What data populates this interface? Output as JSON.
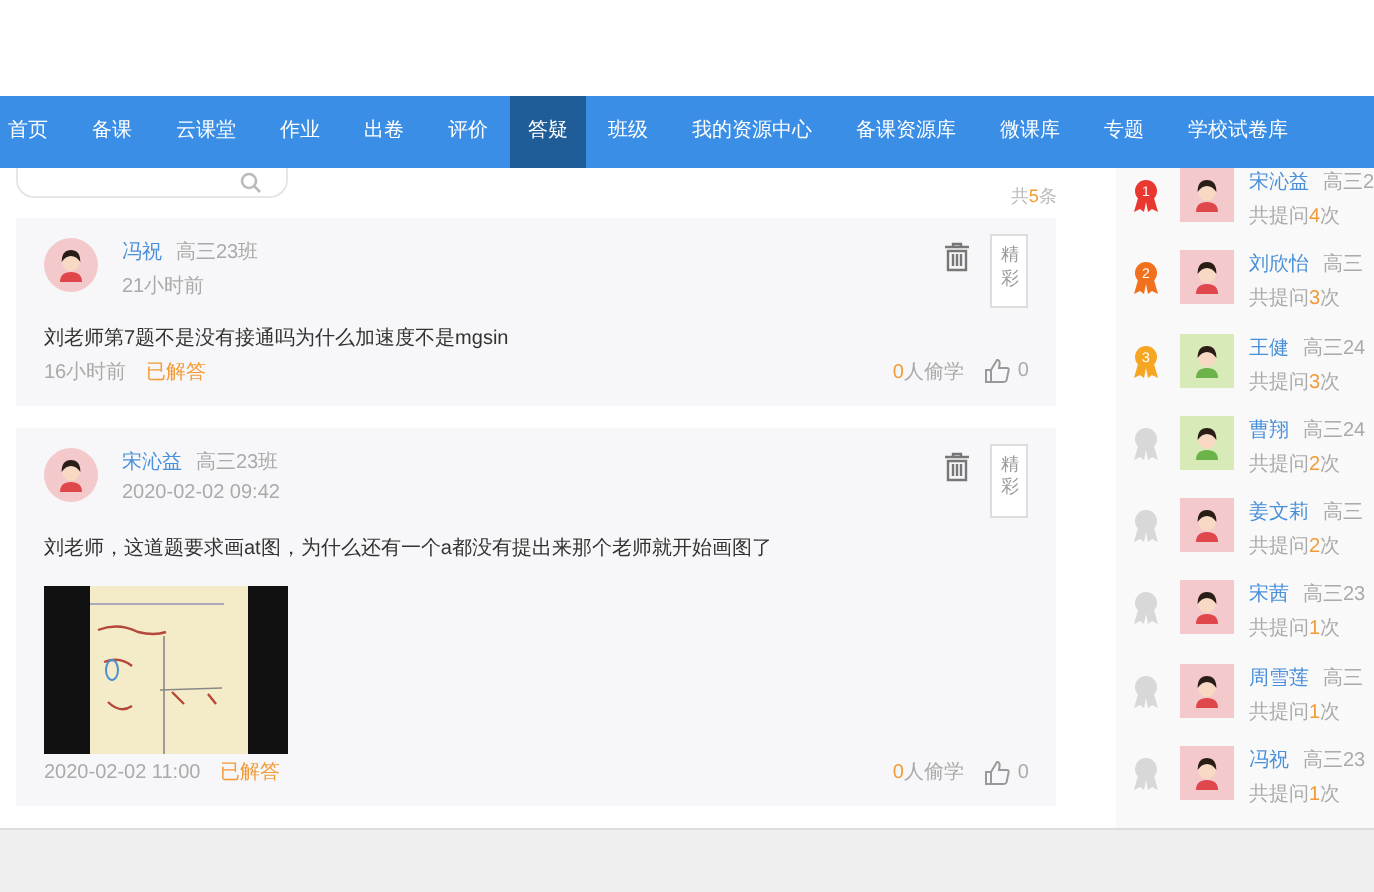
{
  "nav": [
    {
      "label": "首页",
      "selected": false
    },
    {
      "label": "备课",
      "selected": false
    },
    {
      "label": "云课堂",
      "selected": false
    },
    {
      "label": "作业",
      "selected": false
    },
    {
      "label": "出卷",
      "selected": false
    },
    {
      "label": "评价",
      "selected": false
    },
    {
      "label": "答疑",
      "selected": true
    },
    {
      "label": "班级",
      "selected": false
    },
    {
      "label": "我的资源中心",
      "selected": false
    },
    {
      "label": "备课资源库",
      "selected": false
    },
    {
      "label": "微课库",
      "selected": false
    },
    {
      "label": "专题",
      "selected": false
    },
    {
      "label": "学校试卷库",
      "selected": false
    }
  ],
  "total": {
    "prefix": "共",
    "count": "5",
    "suffix": "条"
  },
  "questions": [
    {
      "kind": "girl",
      "name": "冯祝",
      "class": "高三23班",
      "posted": "21小时前",
      "text": "刘老师第7题不是没有接通吗为什么加速度不是mgsin",
      "has_picture": false,
      "answered_time": "16小时前",
      "status": "已解答",
      "tag": "精彩",
      "learn_count": "0",
      "learn_label": "人偷学",
      "likes": "0"
    },
    {
      "kind": "girl",
      "name": "宋沁益",
      "class": "高三23班",
      "posted": "2020-02-02 09:42",
      "text": "刘老师，这道题要求画at图，为什么还有一个a都没有提出来那个老师就开始画图了",
      "has_picture": true,
      "answered_time": "2020-02-02 11:00",
      "status": "已解答",
      "tag": "精彩",
      "learn_count": "0",
      "learn_label": "人偷学",
      "likes": "0"
    }
  ],
  "ranking": [
    {
      "rank": "1",
      "color": "#e8382f",
      "kind": "girl",
      "name": "宋沁益",
      "class": "高三2",
      "prefix": "共提问",
      "count": "4",
      "suffix": "次"
    },
    {
      "rank": "2",
      "color": "#f0701e",
      "kind": "girl",
      "name": "刘欣怡",
      "class": "高三",
      "prefix": "共提问",
      "count": "3",
      "suffix": "次"
    },
    {
      "rank": "3",
      "color": "#f5a623",
      "kind": "boy",
      "name": "王健",
      "class": "高三24",
      "prefix": "共提问",
      "count": "3",
      "suffix": "次"
    },
    {
      "color": "#d8d8d8",
      "kind": "boy",
      "name": "曹翔",
      "class": "高三24",
      "prefix": "共提问",
      "count": "2",
      "suffix": "次"
    },
    {
      "color": "#d8d8d8",
      "kind": "girl",
      "name": "姜文莉",
      "class": "高三",
      "prefix": "共提问",
      "count": "2",
      "suffix": "次"
    },
    {
      "color": "#d8d8d8",
      "kind": "girl",
      "name": "宋茜",
      "class": "高三23",
      "prefix": "共提问",
      "count": "1",
      "suffix": "次"
    },
    {
      "color": "#d8d8d8",
      "kind": "girl",
      "name": "周雪莲",
      "class": "高三",
      "prefix": "共提问",
      "count": "1",
      "suffix": "次"
    },
    {
      "color": "#d8d8d8",
      "kind": "girl",
      "name": "冯祝",
      "class": "高三23",
      "prefix": "共提问",
      "count": "1",
      "suffix": "次"
    }
  ]
}
